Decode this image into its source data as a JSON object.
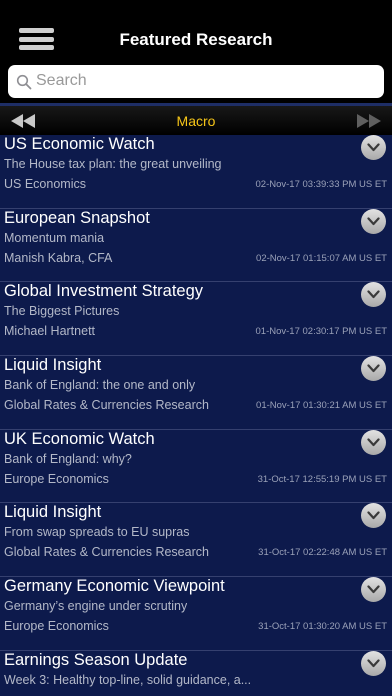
{
  "header": {
    "title": "Featured Research",
    "menu_icon": "hamburger-menu-icon"
  },
  "search": {
    "placeholder": "Search",
    "icon": "search-icon"
  },
  "category_bar": {
    "label": "Macro",
    "prev_icon": "rewind-icon",
    "next_icon": "fast-forward-icon",
    "label_color": "#f5c518"
  },
  "colors": {
    "list_bg": "#0d1a4c",
    "separator": "#1e2e66"
  },
  "items": [
    {
      "title": "US Economic Watch",
      "subtitle": "The House tax plan: the great unveiling",
      "author": "US Economics",
      "date": "02-Nov-17 03:39:33 PM US ET"
    },
    {
      "title": "European Snapshot",
      "subtitle": "Momentum mania",
      "author": "Manish Kabra, CFA",
      "date": "02-Nov-17 01:15:07 AM US ET"
    },
    {
      "title": "Global Investment Strategy",
      "subtitle": "The Biggest Pictures",
      "author": "Michael Hartnett",
      "date": "01-Nov-17 02:30:17 PM US ET"
    },
    {
      "title": "Liquid Insight",
      "subtitle": "Bank of England: the one and only",
      "author": "Global Rates & Currencies Research",
      "date": "01-Nov-17 01:30:21 AM US ET"
    },
    {
      "title": "UK Economic Watch",
      "subtitle": "Bank of England: why?",
      "author": "Europe Economics",
      "date": "31-Oct-17 12:55:19 PM US ET"
    },
    {
      "title": "Liquid Insight",
      "subtitle": "From swap spreads to EU supras",
      "author": "Global Rates & Currencies Research",
      "date": "31-Oct-17 02:22:48 AM US ET"
    },
    {
      "title": "Germany Economic Viewpoint",
      "subtitle": "Germany’s engine under scrutiny",
      "author": "Europe Economics",
      "date": "31-Oct-17 01:30:20 AM US ET"
    },
    {
      "title": "Earnings Season Update",
      "subtitle": "Week 3: Healthy top-line, solid guidance, a...",
      "author": "",
      "date": ""
    }
  ]
}
